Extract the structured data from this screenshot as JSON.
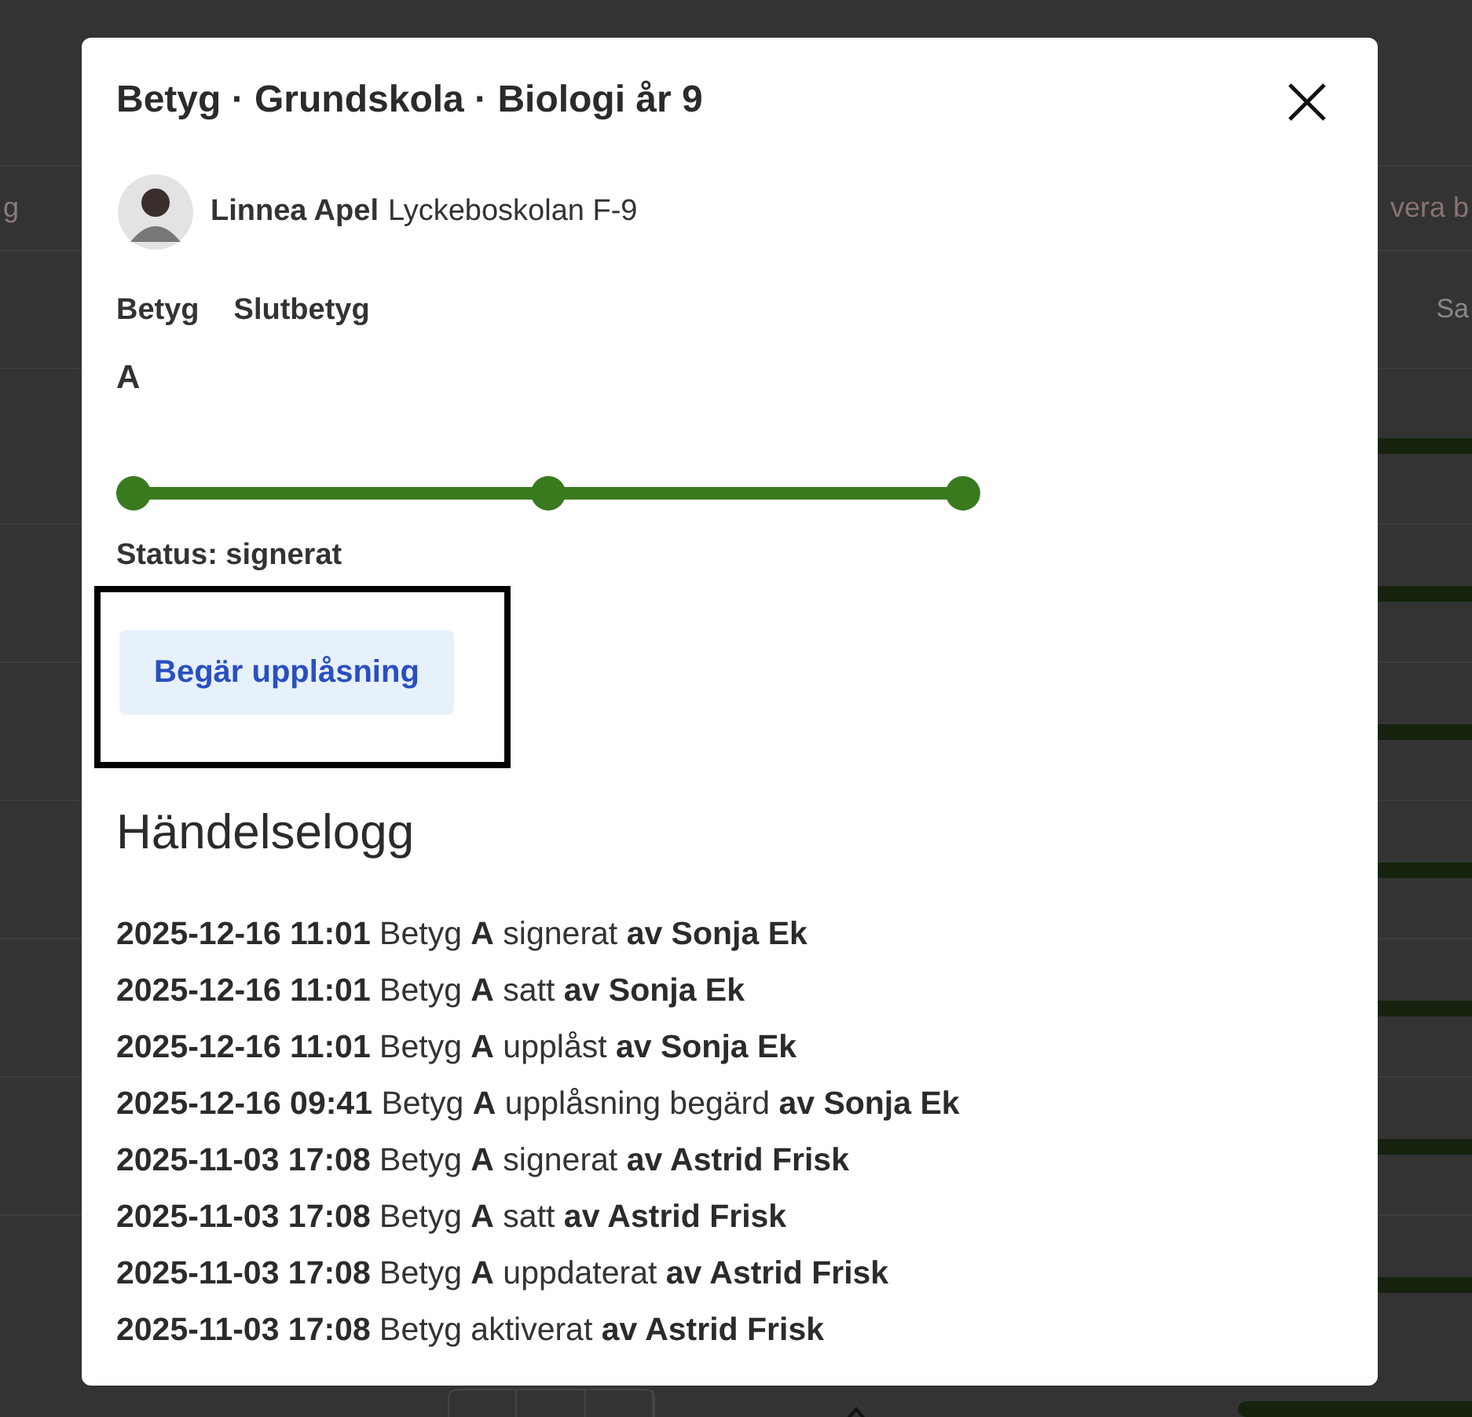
{
  "background": {
    "tab_fragment": "g",
    "button_fragment": "vera b",
    "column_fragment": "Sa"
  },
  "dialog": {
    "title": "Betyg · Grundskola · Biologi år 9",
    "student": {
      "name": "Linnea Apel",
      "school": "Lyckeboskolan F-9"
    },
    "grade_headers": [
      "Betyg",
      "Slutbetyg"
    ],
    "grade": "A",
    "progress_steps": [
      {
        "done": true
      },
      {
        "done": true
      },
      {
        "done": true
      }
    ],
    "status": "Status: signerat",
    "unlock_button": {
      "label": "Begär upplåsning",
      "highlighted": true
    },
    "log_title": "Händelselogg",
    "log": [
      "**2025-12-16 11:01** Betyg **A** signerat **av Sonja Ek**",
      "**2025-12-16 11:01** Betyg **A** satt **av Sonja Ek**",
      "**2025-12-16 11:01** Betyg **A** upplåst **av Sonja Ek**",
      "**2025-12-16 09:41** Betyg **A** upplåsning begärd **av Sonja Ek**",
      "**2025-11-03 17:08** Betyg **A** signerat **av Astrid Frisk**",
      "**2025-11-03 17:08** Betyg **A** satt **av Astrid Frisk**",
      "**2025-11-03 17:08** Betyg **A** uppdaterat **av Astrid Frisk**",
      "**2025-11-03 17:08** Betyg aktiverat **av Astrid Frisk**"
    ]
  }
}
